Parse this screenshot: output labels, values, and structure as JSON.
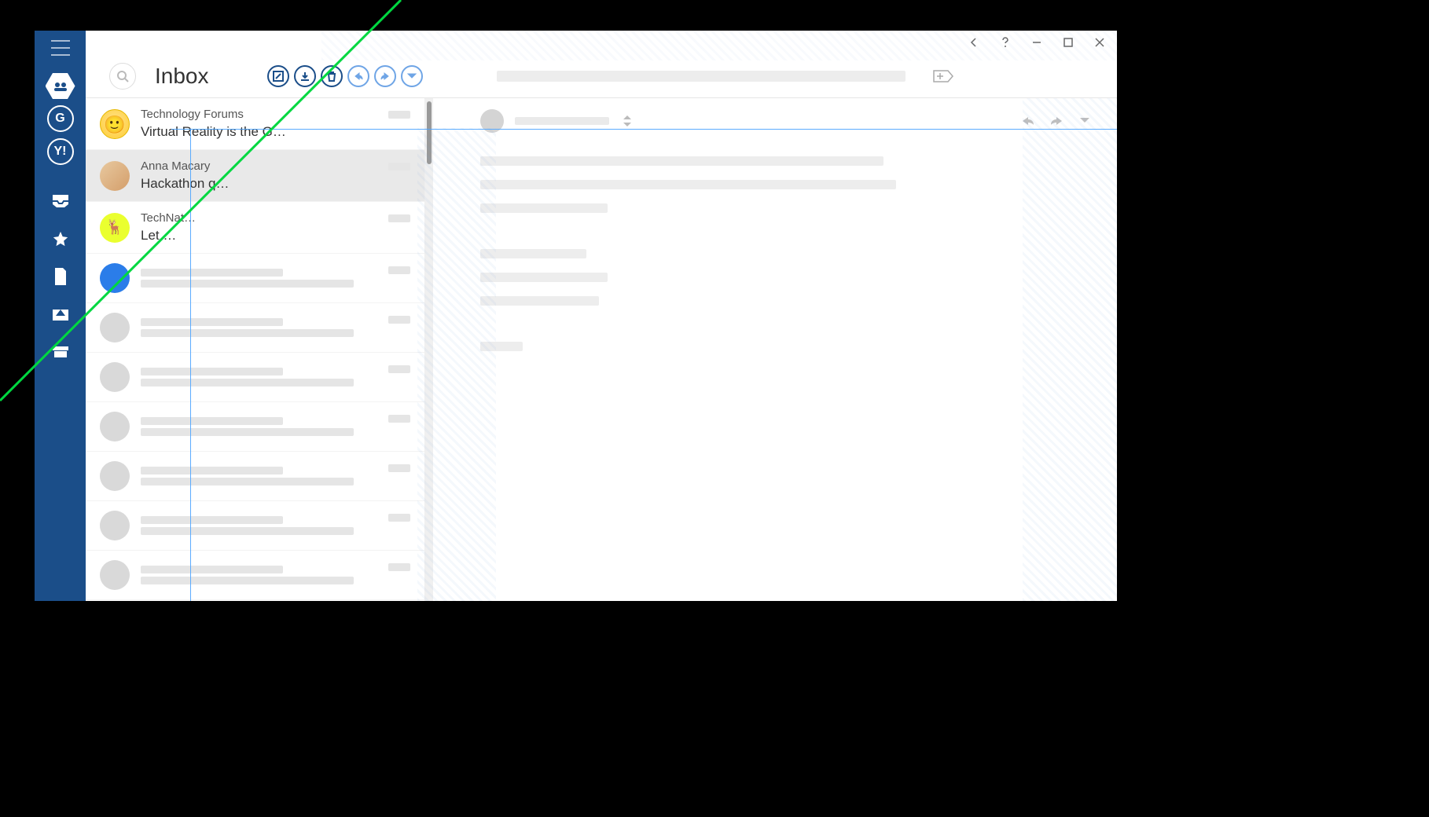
{
  "window": {
    "back_tooltip": "Back",
    "help_tooltip": "Help",
    "min_tooltip": "Minimize",
    "max_tooltip": "Maximize",
    "close_tooltip": "Close"
  },
  "sidebar": {
    "menu_tooltip": "Menu",
    "accounts": [
      {
        "id": "unified",
        "label": "All accounts"
      },
      {
        "id": "google",
        "label": "G"
      },
      {
        "id": "yahoo",
        "label": "Y!"
      }
    ],
    "folders": [
      {
        "id": "inbox",
        "label": "Inbox"
      },
      {
        "id": "starred",
        "label": "Starred"
      },
      {
        "id": "drafts",
        "label": "Drafts"
      },
      {
        "id": "sent",
        "label": "Sent"
      },
      {
        "id": "archive",
        "label": "Archive"
      }
    ]
  },
  "header": {
    "search_tooltip": "Search",
    "title": "Inbox",
    "actions": {
      "compose": "Compose",
      "download": "Download",
      "delete": "Delete",
      "reply": "Reply",
      "forward": "Forward",
      "more": "More"
    },
    "tag_tooltip": "Tag"
  },
  "messages": [
    {
      "sender": "Technology Forums",
      "subject": "Virtual Reality is the G…",
      "avatar": "av-yellow",
      "selected": false,
      "has_text": true
    },
    {
      "sender": "Anna Macary",
      "subject": "Hackathon q…",
      "avatar": "av-photo",
      "selected": true,
      "has_text": true
    },
    {
      "sender": "TechNat…",
      "subject": "Let …",
      "avatar": "av-lime",
      "selected": false,
      "has_text": true
    },
    {
      "sender": "",
      "subject": "",
      "avatar": "av-blue",
      "selected": false,
      "has_text": false
    },
    {
      "sender": "",
      "subject": "",
      "avatar": "av-grey",
      "selected": false,
      "has_text": false
    },
    {
      "sender": "",
      "subject": "",
      "avatar": "av-grey",
      "selected": false,
      "has_text": false
    },
    {
      "sender": "",
      "subject": "",
      "avatar": "av-grey",
      "selected": false,
      "has_text": false
    },
    {
      "sender": "",
      "subject": "",
      "avatar": "av-grey",
      "selected": false,
      "has_text": false
    },
    {
      "sender": "",
      "subject": "",
      "avatar": "av-grey",
      "selected": false,
      "has_text": false
    },
    {
      "sender": "",
      "subject": "",
      "avatar": "av-grey",
      "selected": false,
      "has_text": false
    }
  ],
  "reading": {
    "reply_tooltip": "Reply",
    "forward_tooltip": "Forward",
    "more_tooltip": "More"
  },
  "colors": {
    "brand": "#1b4e89",
    "accent_line": "#00d840"
  }
}
